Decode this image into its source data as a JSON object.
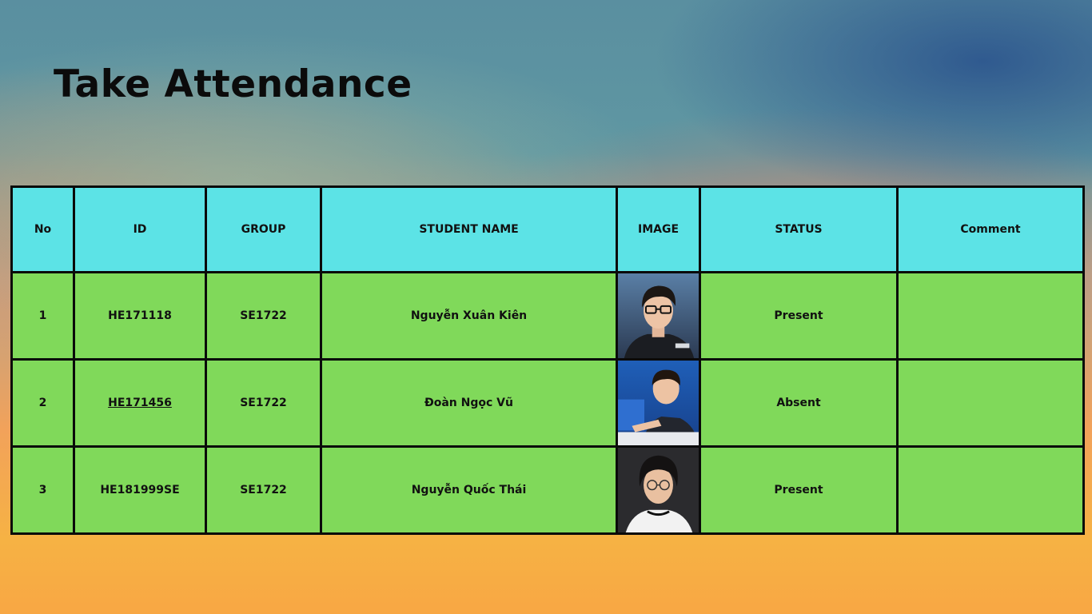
{
  "page": {
    "title": "Take Attendance"
  },
  "table": {
    "headers": [
      "No",
      "ID",
      "GROUP",
      "STUDENT NAME",
      "IMAGE",
      "STATUS",
      "Comment"
    ],
    "rows": [
      {
        "no": "1",
        "id": "HE171118",
        "group": "SE1722",
        "name": "Nguyễn Xuân Kiên",
        "image": "student-photo",
        "status": "Present",
        "comment": ""
      },
      {
        "no": "2",
        "id": "HE171456",
        "group": "SE1722",
        "name": "Đoàn Ngọc Vũ",
        "image": "student-photo",
        "status": "Absent",
        "comment": ""
      },
      {
        "no": "3",
        "id": "HE181999SE",
        "group": "SE1722",
        "name": "Nguyễn Quốc Thái",
        "image": "student-photo",
        "status": "Present",
        "comment": ""
      }
    ]
  },
  "colors": {
    "header_bg": "#5ce3e6",
    "row_bg": "#80d95a",
    "border": "#0a0a0a"
  }
}
